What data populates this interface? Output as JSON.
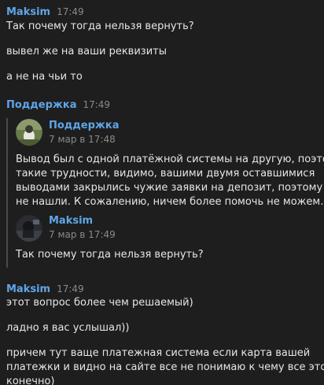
{
  "messages": {
    "m1": {
      "author": "Maksim",
      "time": "17:49",
      "lines": [
        "Так почему тогда нельзя вернуть?",
        "вывел же на ваши реквизиты",
        "а не на чьи то"
      ]
    },
    "m2": {
      "author": "Поддержка",
      "time": "17:49",
      "forward1": {
        "author": "Поддержка",
        "date": "7 мар в 17:48",
        "text_lines": [
          "Вывод был с одной платёжной системы на другую, поэтому",
          "такие трудности, видимо, вашими двумя оставшимися",
          "выводами закрылись чужие заявки на депозит, поэтому и",
          "не нашли. К сожалению, ничем более помочь не можем."
        ]
      },
      "forward2": {
        "author": "Maksim",
        "date": "7 мар в 17:49",
        "text": "Так почему тогда нельзя вернуть?"
      }
    },
    "m3": {
      "author": "Maksim",
      "time": "17:49",
      "lines": [
        "этот вопрос более чем решаемый)",
        "ладно я вас услышал))"
      ],
      "long_lines": [
        "причем тут ваще платежная система если карта вашей",
        "платежки и видно на сайте все не понимаю к чему все это",
        "конечно)"
      ]
    }
  },
  "colors": {
    "background": "#1e1e1e",
    "author_name": "#5fa6e8",
    "timestamp": "#8a8a8a",
    "text": "#e6e6e6",
    "forward_bar": "#4a4a4a"
  },
  "icons": {
    "support_avatar": "support-avatar-photo",
    "maksim_avatar": "maksim-avatar-photo"
  }
}
